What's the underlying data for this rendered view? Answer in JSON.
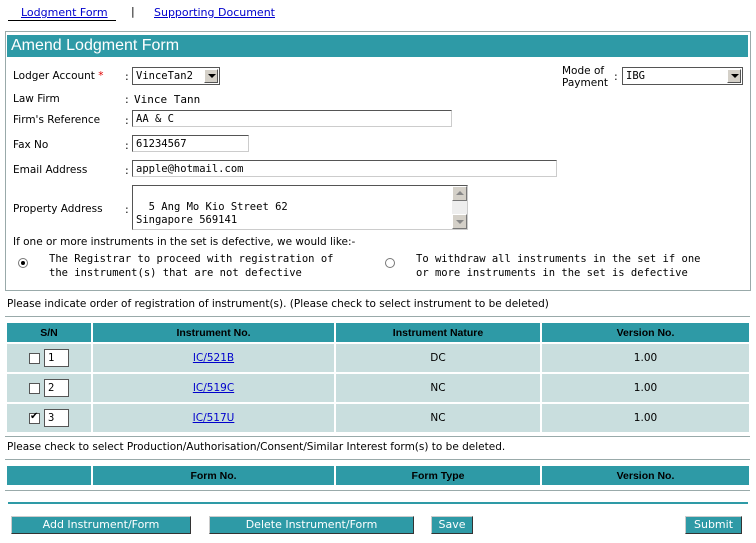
{
  "tabs": [
    {
      "label": "Lodgment Form"
    },
    {
      "label": "Supporting Document"
    }
  ],
  "tab_separator": "|",
  "page_title": "Amend Lodgment Form",
  "form": {
    "lodger_account_label": "Lodger Account",
    "required_mark": "*",
    "lodger_account_value": "VinceTan2",
    "mode_of_payment_label_1": "Mode of",
    "mode_of_payment_label_2": "Payment",
    "mode_of_payment_value": "IBG",
    "law_firm_label": "Law Firm",
    "law_firm_value": "Vince Tann",
    "firms_reference_label": "Firm's Reference",
    "firms_reference_value": "AA & C",
    "fax_no_label": "Fax No",
    "fax_no_value": "61234567",
    "email_label": "Email Address",
    "email_value": "apple@hotmail.com",
    "property_address_label": "Property Address",
    "property_address_value": "5 Ang Mo Kio Street 62\nSingapore 569141",
    "colon": ":",
    "defective_prompt": "If one or more instruments in the set is defective, we would like:-",
    "option_1_line_1": "The Registrar to proceed with registration of",
    "option_1_line_2": "the instrument(s) that are not defective",
    "option_1_selected": true,
    "option_2_line_1": "To withdraw all instruments in the set if one",
    "option_2_line_2": "or more instruments in the set is defective",
    "option_2_selected": false
  },
  "instruments": {
    "instruction": "Please indicate order of registration of instrument(s). (Please check to select instrument to be deleted)",
    "headers": [
      "S/N",
      "Instrument No.",
      "Instrument Nature",
      "Version No."
    ],
    "rows": [
      {
        "checked": false,
        "sn": "1",
        "number": "IC/521B",
        "nature": "DC",
        "version": "1.00"
      },
      {
        "checked": false,
        "sn": "2",
        "number": "IC/519C",
        "nature": "NC",
        "version": "1.00"
      },
      {
        "checked": true,
        "sn": "3",
        "number": "IC/517U",
        "nature": "NC",
        "version": "1.00"
      }
    ]
  },
  "forms": {
    "instruction": "Please check to select Production/Authorisation/Consent/Similar Interest form(s) to be deleted.",
    "headers": [
      "",
      "Form No.",
      "Form Type",
      "Version No."
    ]
  },
  "buttons": {
    "add": "Add Instrument/Form",
    "delete": "Delete Instrument/Form",
    "save": "Save",
    "submit": "Submit"
  },
  "colors": {
    "accent": "#2e9aa6",
    "row_bg": "#c9dede",
    "required": "#e00000",
    "link": "#0000cc"
  }
}
